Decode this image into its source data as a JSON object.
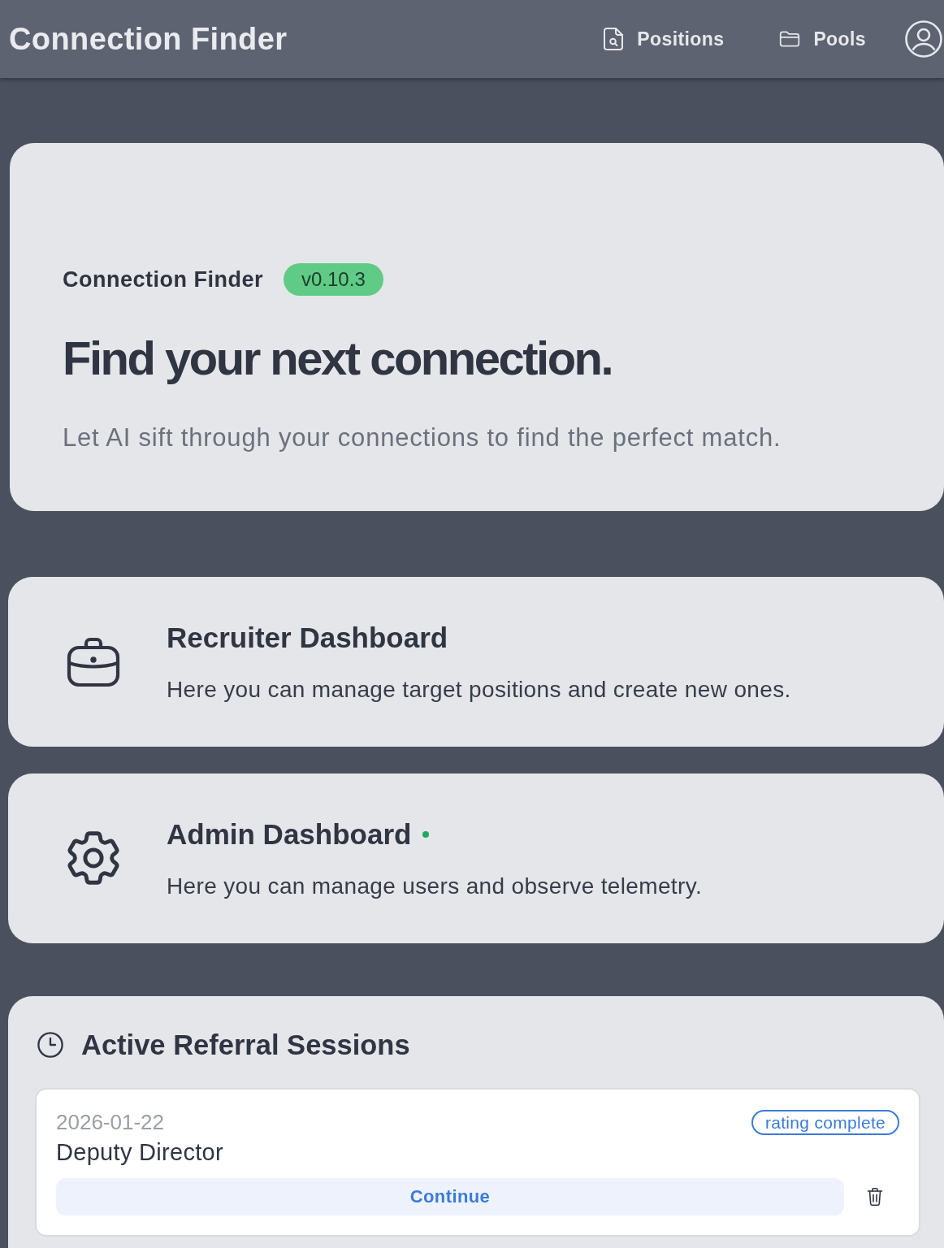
{
  "navbar": {
    "brand": "Connection Finder",
    "links": [
      {
        "label": "Positions"
      },
      {
        "label": "Pools"
      }
    ]
  },
  "hero": {
    "app_name": "Connection Finder",
    "version": "v0.10.3",
    "heading": "Find your next connection.",
    "subtitle": "Let AI sift through your connections to find the perfect match."
  },
  "dashboards": [
    {
      "title": "Recruiter Dashboard",
      "description": "Here you can manage target positions and create new ones.",
      "status_dot": false
    },
    {
      "title": "Admin Dashboard",
      "description": "Here you can manage users and observe telemetry.",
      "status_dot": true
    }
  ],
  "sessions": {
    "title": "Active Referral Sessions",
    "items": [
      {
        "date": "2026-01-22",
        "title": "Deputy Director",
        "status": "rating complete",
        "action": "Continue"
      }
    ]
  }
}
